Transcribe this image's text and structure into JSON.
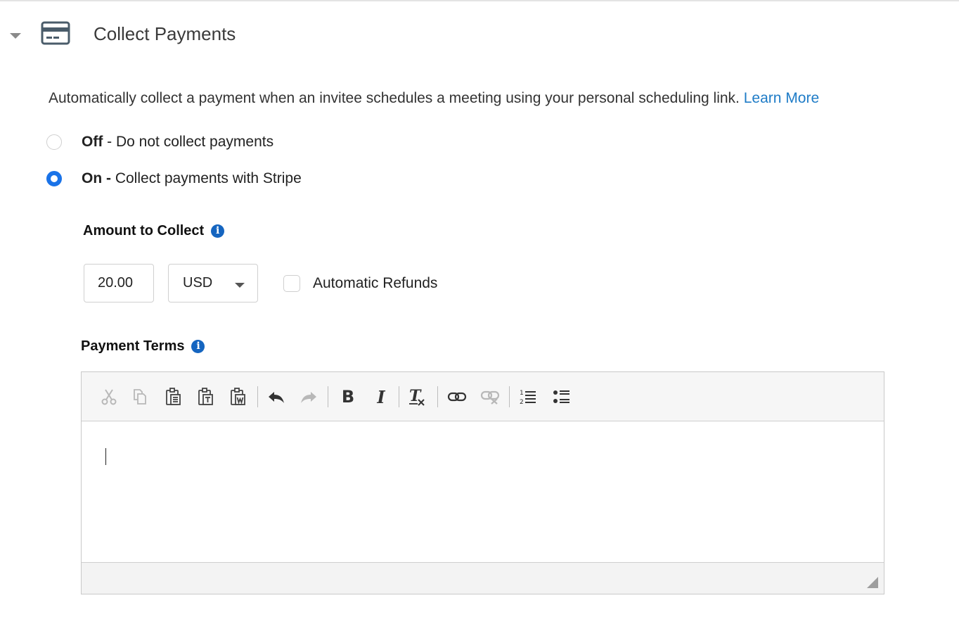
{
  "section": {
    "title": "Collect Payments",
    "icon": "credit-card-icon"
  },
  "description": {
    "text": "Automatically collect a payment when an invitee schedules a meeting using your personal scheduling link.",
    "link_label": "Learn More"
  },
  "payment_options": [
    {
      "label": "Off",
      "suffix": " - Do not collect payments",
      "selected": false
    },
    {
      "label": "On -",
      "suffix": " Collect payments with Stripe",
      "selected": true
    }
  ],
  "amount": {
    "label": "Amount to Collect",
    "value": "20.00",
    "currency": "USD",
    "auto_refunds_label": "Automatic Refunds",
    "auto_refunds_checked": false
  },
  "terms": {
    "label": "Payment Terms",
    "content": ""
  },
  "colors": {
    "accent": "#1a73e8",
    "link": "#1f7cc7",
    "info_icon": "#1565c0"
  },
  "toolbar_icons": [
    "cut-icon",
    "copy-icon",
    "paste-icon",
    "paste-text-icon",
    "paste-word-icon",
    "undo-icon",
    "redo-icon",
    "bold-icon",
    "italic-icon",
    "remove-format-icon",
    "link-icon",
    "unlink-icon",
    "numbered-list-icon",
    "bulleted-list-icon"
  ]
}
